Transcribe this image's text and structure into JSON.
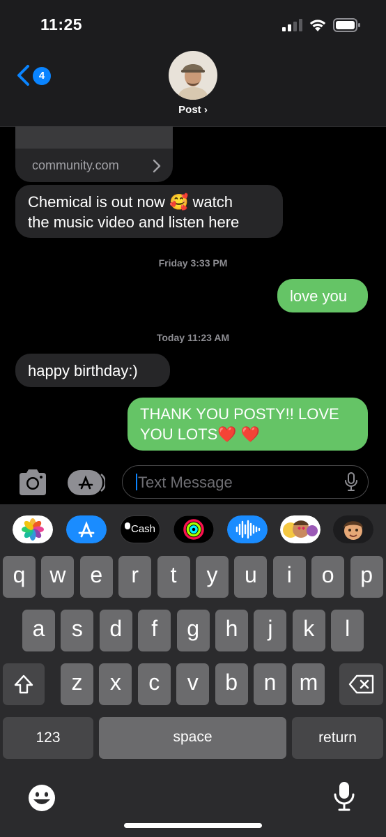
{
  "status_bar": {
    "time": "11:25"
  },
  "header": {
    "back_badge": "4",
    "contact_name": "Post ›"
  },
  "messages": {
    "link_domain": "community.com",
    "incoming_1_line1": "Chemical is out now 🥰 watch",
    "incoming_1_line2": "the music video and listen here",
    "timestamp_1": "Friday 3:33 PM",
    "outgoing_1": "love you",
    "timestamp_2": "Today 11:23 AM",
    "incoming_2": "happy birthday:)",
    "outgoing_2_line1": "THANK YOU POSTY!! LOVE",
    "outgoing_2_line2": "YOU LOTS❤️ ❤️"
  },
  "composer": {
    "placeholder": "Text Message"
  },
  "app_drawer": {
    "cash_label": "Cash"
  },
  "keyboard": {
    "row1": [
      "q",
      "w",
      "e",
      "r",
      "t",
      "y",
      "u",
      "i",
      "o",
      "p"
    ],
    "row2": [
      "a",
      "s",
      "d",
      "f",
      "g",
      "h",
      "j",
      "k",
      "l"
    ],
    "row3": [
      "z",
      "x",
      "c",
      "v",
      "b",
      "n",
      "m"
    ],
    "numbers_label": "123",
    "space_label": "space",
    "return_label": "return"
  },
  "colors": {
    "incoming_bubble": "#262628",
    "outgoing_bubble": "#65c466",
    "accent": "#0a84ff"
  }
}
